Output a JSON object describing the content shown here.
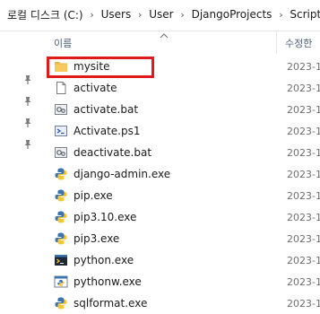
{
  "breadcrumb": {
    "items": [
      "로컬 디스크 (C:)",
      "Users",
      "User",
      "DjangoProjects",
      "Scripts"
    ]
  },
  "columns": {
    "name": "이름",
    "date": "수정한"
  },
  "files": [
    {
      "name": "mysite",
      "date": "2023-1",
      "icon": "folder-icon"
    },
    {
      "name": "activate",
      "date": "2023-1",
      "icon": "file-icon"
    },
    {
      "name": "activate.bat",
      "date": "2023-1",
      "icon": "batch-file-icon"
    },
    {
      "name": "Activate.ps1",
      "date": "2023-1",
      "icon": "powershell-script-icon"
    },
    {
      "name": "deactivate.bat",
      "date": "2023-1",
      "icon": "batch-file-icon"
    },
    {
      "name": "django-admin.exe",
      "date": "2023-1",
      "icon": "python-exe-icon"
    },
    {
      "name": "pip.exe",
      "date": "2023-1",
      "icon": "python-exe-icon"
    },
    {
      "name": "pip3.10.exe",
      "date": "2023-1",
      "icon": "python-exe-icon"
    },
    {
      "name": "pip3.exe",
      "date": "2023-1",
      "icon": "python-exe-icon"
    },
    {
      "name": "python.exe",
      "date": "2023-1",
      "icon": "python-console-icon"
    },
    {
      "name": "pythonw.exe",
      "date": "2023-1",
      "icon": "python-window-icon"
    },
    {
      "name": "sqlformat.exe",
      "date": "2023-1",
      "icon": "python-exe-icon"
    }
  ],
  "highlighted_item": "mysite",
  "colors": {
    "highlight_border": "#e0191b",
    "folder": "#f8c95c",
    "header_text": "#4c607a"
  }
}
